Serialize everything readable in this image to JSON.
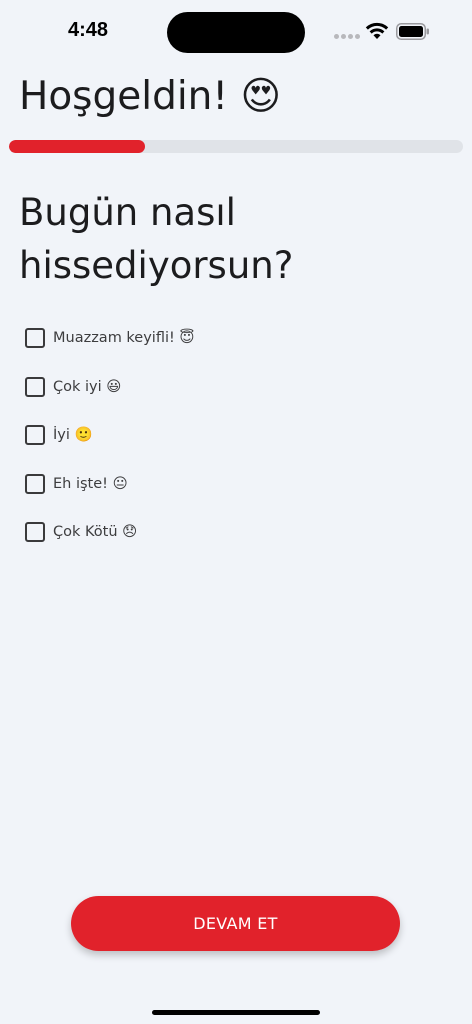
{
  "status_bar": {
    "time": "4:48"
  },
  "header": {
    "title": "Hoşgeldin! 😍"
  },
  "progress": {
    "value": 0.3,
    "color": "#e1222b",
    "track_color": "#e0e3e8"
  },
  "question": {
    "text": "Bugün nasıl hissediyorsun?"
  },
  "options": [
    {
      "label": "Muazzam keyifli!  😇",
      "checked": false
    },
    {
      "label": "Çok iyi 😃",
      "checked": false
    },
    {
      "label": "İyi 🙂",
      "checked": false
    },
    {
      "label": "Eh işte! 😐",
      "checked": false
    },
    {
      "label": "Çok Kötü 😞",
      "checked": false
    }
  ],
  "footer": {
    "continue_label": "DEVAM ET"
  },
  "colors": {
    "accent": "#e1222b",
    "background": "#f1f4f9"
  }
}
